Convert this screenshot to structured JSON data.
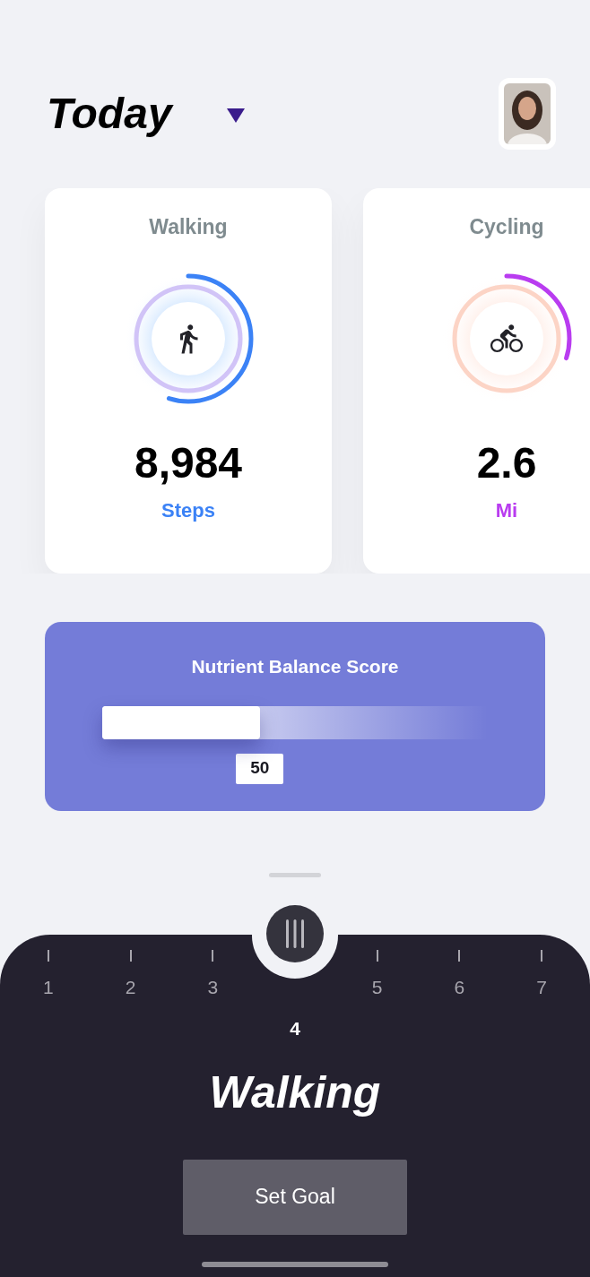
{
  "header": {
    "title": "Today"
  },
  "metrics": [
    {
      "kind": "walking",
      "name": "Walking",
      "value": "8,984",
      "unit": "Steps",
      "level": 0.55,
      "color": "#3b82f6"
    },
    {
      "kind": "cycling",
      "name": "Cycling",
      "value": "2.6",
      "unit": "Mi",
      "level": 0.3,
      "color": "#b93cf0"
    }
  ],
  "score": {
    "title": "Nutrient Balance Score",
    "level": 0.41,
    "reading": "50"
  },
  "picker": {
    "days": [
      {
        "label": "1",
        "selected": false
      },
      {
        "label": "2",
        "selected": false
      },
      {
        "label": "3",
        "selected": false
      },
      {
        "label": "4",
        "selected": true
      },
      {
        "label": "5",
        "selected": false
      },
      {
        "label": "6",
        "selected": false
      },
      {
        "label": "7",
        "selected": false
      }
    ],
    "title": "Walking",
    "button": "Set Goal"
  }
}
